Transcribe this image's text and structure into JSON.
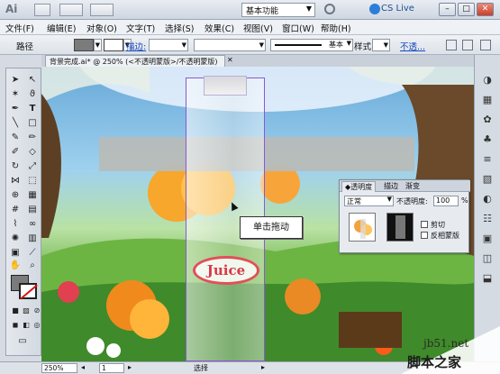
{
  "titlebar": {
    "app_logo": "Ai",
    "workspace": "基本功能",
    "cslive": "CS Live",
    "window_controls": [
      "–",
      "□",
      "✕"
    ]
  },
  "menu": {
    "items": [
      "文件(F)",
      "编辑(E)",
      "对象(O)",
      "文字(T)",
      "选择(S)",
      "效果(C)",
      "视图(V)",
      "窗口(W)",
      "帮助(H)"
    ]
  },
  "control_bar": {
    "path_label": "路径",
    "stroke_label": "描边:",
    "stroke_style": "基本",
    "style_label": "样式:",
    "opacity_link": "不透...",
    "fill_color": "#7b7b7b"
  },
  "document": {
    "tab_title": "背景完成.ai* @ 250% (<不透明蒙版>/不透明蒙版)",
    "tab_close": "✕"
  },
  "canvas": {
    "logo_text": "Juice",
    "tooltip": "单击拖动",
    "banner_color": "#b7bcb8"
  },
  "transparency_panel": {
    "tabs": [
      "◆透明度",
      "描边",
      "渐变"
    ],
    "blend_mode": "正常",
    "opacity_label": "不透明度:",
    "opacity_value": "100",
    "opacity_unit": "%",
    "clip_label": "剪切",
    "invert_label": "反相蒙版"
  },
  "statusbar": {
    "zoom": "250%",
    "page": "1",
    "status": "选择"
  },
  "watermark": {
    "site": "jb51.net",
    "name": "脚本之家"
  }
}
